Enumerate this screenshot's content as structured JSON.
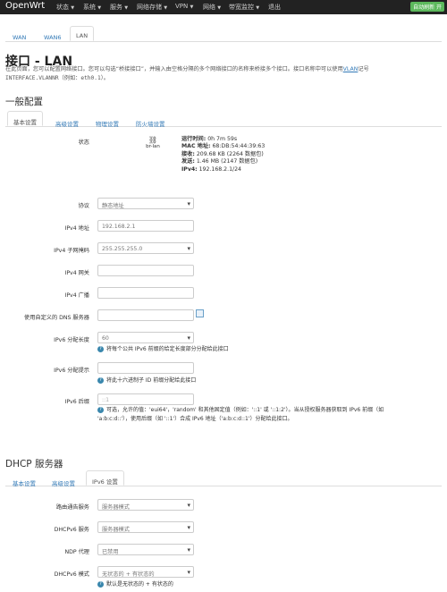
{
  "nav": {
    "brand": "OpenWrt",
    "menu": [
      "状态",
      "系统",
      "服务",
      "网络存储",
      "VPN",
      "网络",
      "带宽监控",
      "退出"
    ],
    "autorefresh": "自动刷新 开"
  },
  "iface_tabs": [
    "WAN",
    "WAN6",
    "LAN"
  ],
  "page": {
    "title": "接口 - LAN",
    "desc_1a": "在此页面，您可以配置网络接口。您可以勾选“桥接接口”，并输入由空格分隔的多个网络接口的名称来桥接多个接口。接口名称中可以使用",
    "desc_1b": "VLAN",
    "desc_1c": "记号",
    "desc_2": "INTERFACE.VLANNR（例如：eth0.1）。"
  },
  "general": {
    "heading": "一般配置",
    "tabs": [
      "基本设置",
      "高级设置",
      "物理设置",
      "防火墙设置"
    ],
    "status": {
      "label": "状态",
      "iface": "br-lan",
      "uptime_k": "运行时间:",
      "uptime_v": "0h 7m 59s",
      "mac_k": "MAC 地址:",
      "mac_v": "68:DB:54:44:39:63",
      "rx_k": "接收:",
      "rx_v": "209.68 KB (2264 数据包)",
      "tx_k": "发送:",
      "tx_v": "1.46 MB (2147 数据包)",
      "ipv4_k": "IPv4:",
      "ipv4_v": "192.168.2.1/24"
    },
    "fields": {
      "protocol_label": "协议",
      "protocol_value": "静态地址",
      "ipv4_addr_label": "IPv4 地址",
      "ipv4_addr_value": "192.168.2.1",
      "netmask_label": "IPv4 子网掩码",
      "netmask_value": "255.255.255.0",
      "gateway_label": "IPv4 网关",
      "broadcast_label": "IPv4 广播",
      "dns_label": "使用自定义的 DNS 服务器",
      "ip6assign_label": "IPv6 分配长度",
      "ip6assign_value": "60",
      "ip6assign_hint": "将每个公共 IPv6 前缀的给定长度部分分配给此接口",
      "ip6hint_label": "IPv6 分配提示",
      "ip6hint_hint": "将此十六进制子 ID 前缀分配给此接口",
      "ip6suffix_label": "IPv6 后缀",
      "ip6suffix_value": "::1",
      "ip6suffix_hint_1": "可选，允许的值：'eui64'，'random' 和其他固定值（例如：'::1' 或 '::1:2'）。当从授权服务器获取到 IPv6 前缀（如",
      "ip6suffix_hint_2": "'a:b:c:d::'），使用后缀（如 '::1'）合成 IPv6 地址（'a:b:c:d::1'）分配给此接口。"
    }
  },
  "dhcp": {
    "heading": "DHCP 服务器",
    "tabs": [
      "基本设置",
      "高级设置",
      "IPv6 设置"
    ],
    "fields": {
      "ra_label": "路由通告服务",
      "ra_value": "服务器模式",
      "dhcpv6_label": "DHCPv6 服务",
      "dhcpv6_value": "服务器模式",
      "ndp_label": "NDP 代理",
      "ndp_value": "已禁用",
      "mode_label": "DHCPv6 模式",
      "mode_value": "无状态的 + 有状态的",
      "mode_hint": "默认是无状态的 + 有状态的"
    }
  }
}
